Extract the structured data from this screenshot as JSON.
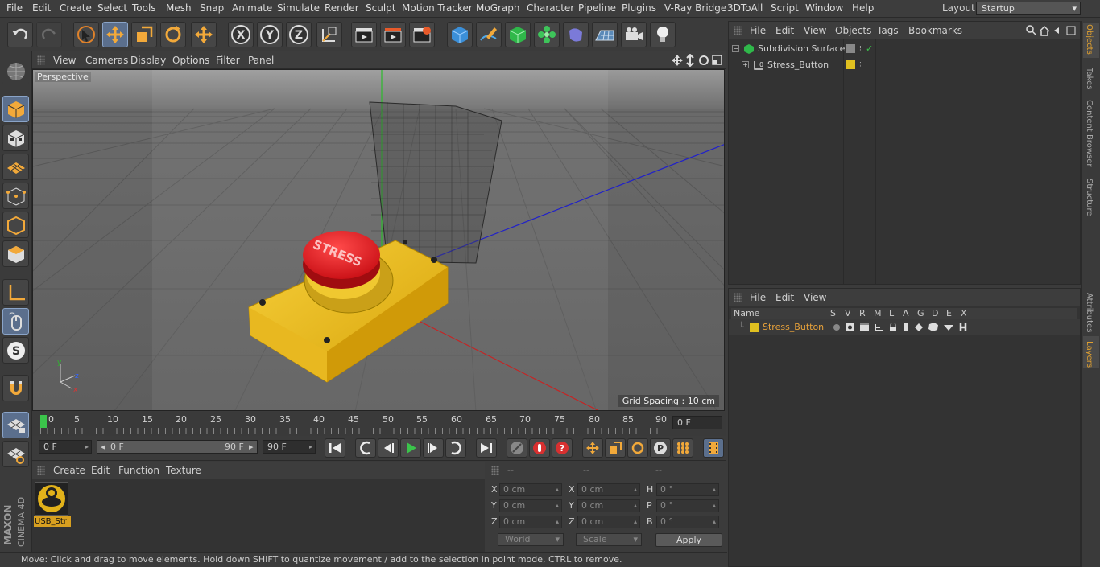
{
  "menubar": {
    "items": [
      "File",
      "Edit",
      "Create",
      "Select",
      "Tools",
      "Mesh",
      "Snap",
      "Animate",
      "Simulate",
      "Render",
      "Sculpt",
      "Motion Tracker",
      "MoGraph",
      "Character",
      "Pipeline",
      "Plugins",
      "V-Ray Bridge",
      "3DToAll",
      "Script",
      "Window",
      "Help"
    ],
    "layout_label": "Layout:",
    "layout_value": "Startup"
  },
  "viewport": {
    "menu": [
      "View",
      "Cameras",
      "Display",
      "Options",
      "Filter",
      "Panel"
    ],
    "label": "Perspective",
    "grid_spacing": "Grid Spacing : 10 cm",
    "button_text": "STRESS"
  },
  "timeline": {
    "ticks": [
      "0",
      "5",
      "10",
      "15",
      "20",
      "25",
      "30",
      "35",
      "40",
      "45",
      "50",
      "55",
      "60",
      "65",
      "70",
      "75",
      "80",
      "85",
      "90"
    ],
    "current_frame": "0 F"
  },
  "transport": {
    "start": "0 F",
    "range_start": "0 F",
    "range_end": "90 F",
    "end": "90 F"
  },
  "material_manager": {
    "menu": [
      "Create",
      "Edit",
      "Function",
      "Texture"
    ],
    "material_name": "USB_Str"
  },
  "coordinates": {
    "headers": [
      "--",
      "--",
      "--"
    ],
    "rows": [
      {
        "a": "X",
        "av": "0 cm",
        "b": "X",
        "bv": "0 cm",
        "c": "H",
        "cv": "0 °"
      },
      {
        "a": "Y",
        "av": "0 cm",
        "b": "Y",
        "bv": "0 cm",
        "c": "P",
        "cv": "0 °"
      },
      {
        "a": "Z",
        "av": "0 cm",
        "b": "Z",
        "bv": "0 cm",
        "c": "B",
        "cv": "0 °"
      }
    ],
    "space": "World",
    "mode": "Scale",
    "apply": "Apply"
  },
  "status": "Move: Click and drag to move elements. Hold down SHIFT to quantize movement / add to the selection in point mode, CTRL to remove.",
  "object_manager": {
    "menu": [
      "File",
      "Edit",
      "View",
      "Objects",
      "Tags",
      "Bookmarks"
    ],
    "objects": [
      "Subdivision Surface",
      "Stress_Button"
    ]
  },
  "layer_manager": {
    "menu": [
      "File",
      "Edit",
      "View"
    ],
    "columns": [
      "Name",
      "S",
      "V",
      "R",
      "M",
      "L",
      "A",
      "G",
      "D",
      "E",
      "X"
    ],
    "layer_name": "Stress_Button"
  },
  "right_tabs": [
    "Objects",
    "Takes",
    "Content Browser",
    "Structure",
    "Attributes",
    "Layers"
  ],
  "brand": [
    "MAXON",
    "CINEMA 4D"
  ],
  "colors": {
    "accent": "#5b6f8d",
    "layer": "#e0c020",
    "selected_text": "#e8a23a"
  }
}
